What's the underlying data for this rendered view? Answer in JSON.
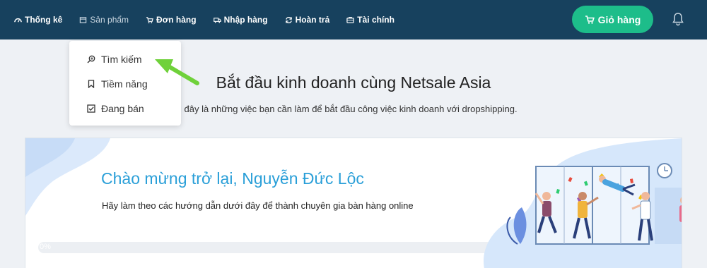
{
  "nav": {
    "items": [
      {
        "label": "Thống kê",
        "icon": "dashboard-icon"
      },
      {
        "label": "Sản phẩm",
        "icon": "box-icon"
      },
      {
        "label": "Đơn hàng",
        "icon": "cart-icon"
      },
      {
        "label": "Nhập hàng",
        "icon": "truck-icon"
      },
      {
        "label": "Hoàn trả",
        "icon": "refresh-icon"
      },
      {
        "label": "Tài chính",
        "icon": "wallet-icon"
      }
    ],
    "cart_button": "Giỏ hàng"
  },
  "dropdown": {
    "items": [
      {
        "label": "Tìm kiếm",
        "icon": "search-icon"
      },
      {
        "label": "Tiềm năng",
        "icon": "bookmark-icon"
      },
      {
        "label": "Đang bán",
        "icon": "checkbox-icon"
      }
    ]
  },
  "main": {
    "headline": "Bắt đầu kinh doanh cùng Netsale Asia",
    "subline": "i đây là những việc bạn cần làm để bắt đầu công việc kinh doanh với dropshipping."
  },
  "card": {
    "welcome": "Chào mừng trở lại, Nguyễn Đức Lộc",
    "guide": "Hãy làm theo các hướng dẫn dưới đây để thành chuyên gia bàn hàng online",
    "progress_label": "0%",
    "progress_value": 0
  },
  "colors": {
    "topbar": "#17415e",
    "accent_green": "#1dbd8a",
    "welcome_blue": "#2a9fd8",
    "arrow_green": "#6fd13a"
  }
}
